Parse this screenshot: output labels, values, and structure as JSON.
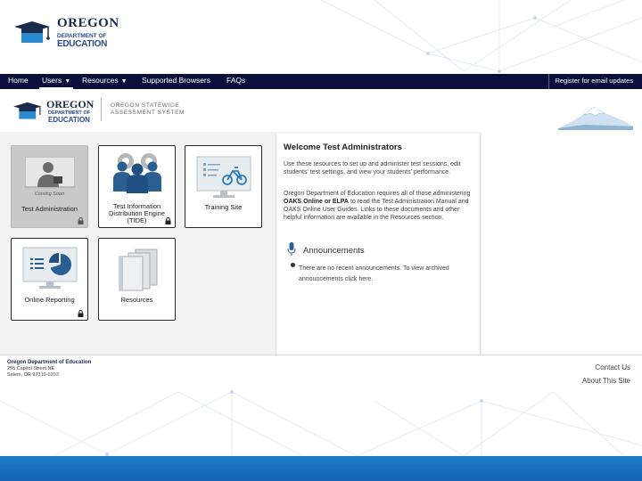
{
  "brand": {
    "top_line1": "OREGON",
    "top_line2": "DEPARTMENT OF",
    "top_line3": "EDUCATION",
    "colors": {
      "navy": "#0a0f3c",
      "brand_blue": "#2a4a8a",
      "bottom_bar": "#1e7cc8"
    }
  },
  "nav": {
    "items": [
      {
        "label": "Home"
      },
      {
        "label": "Users"
      },
      {
        "label": "Resources"
      },
      {
        "label": "Supported Browsers"
      },
      {
        "label": "FAQs"
      }
    ],
    "caret": "▼",
    "register": "Register for email updates"
  },
  "header": {
    "logo_line1": "OREGON",
    "logo_line2": "DEPARTMENT OF",
    "logo_line3": "EDUCATION",
    "system_line1": "OREGON STATEWIDE",
    "system_line2": "ASSESSMENT SYSTEM"
  },
  "tiles": [
    {
      "label": "Test Administration",
      "note": "Coming Soon",
      "icon": "person-at-computer-icon",
      "locked": true,
      "disabled": true
    },
    {
      "label": "Test Information Distribution Engine (TIDE)",
      "icon": "people-gears-icon",
      "locked": true
    },
    {
      "label": "Training Site",
      "icon": "monitor-bike-icon",
      "locked": false
    },
    {
      "label": "Online Reporting",
      "icon": "monitor-pie-chart-icon",
      "locked": true
    },
    {
      "label": "Resources",
      "icon": "books-icon",
      "locked": false
    }
  ],
  "welcome": {
    "title": "Welcome Test Administrators",
    "p1": "Use these resources to set up and administer test sessions, edit students' test settings, and view your students' performance.",
    "p2_a": "Oregon Department of Education requires all of those administering ",
    "p2_b": "OAKS Online or ELPA",
    "p2_c": " to read the Test Administration Manual and OAKS Online User Guides. Links to these documents and other helpful information are available in the Resources section.",
    "ann_title": "Announcements",
    "ann_text": "There are no recent announcements. To view archived announcements click here."
  },
  "footer": {
    "org": "Oregon Department of Education",
    "addr1": "255 Capitol Street NE",
    "addr2": "Salem, OR 97310-0203",
    "contact": "Contact Us",
    "about": "About This Site"
  }
}
